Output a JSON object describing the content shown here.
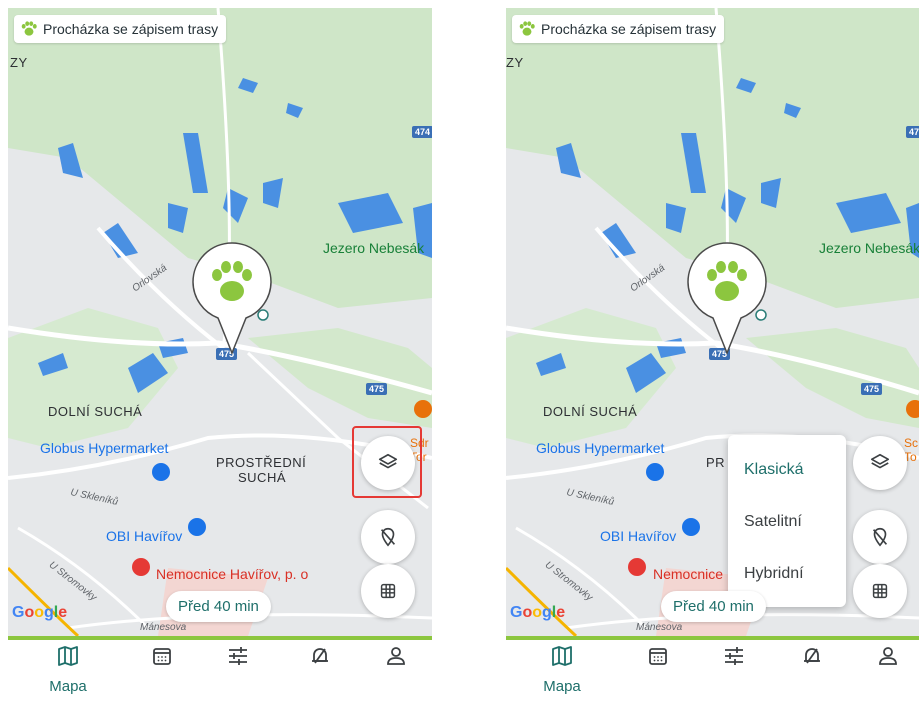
{
  "left": {
    "title": "Procházka se zápisem trasy",
    "map_labels": {
      "top_left_fragment": "ZY",
      "lake": "Jezero Nebesák",
      "dolni": "DOLNÍ SUCHÁ",
      "globus": "Globus Hypermarket",
      "prostredni_1": "PROSTŘEDNÍ",
      "prostredni_2": "SUCHÁ",
      "obi": "OBI Havířov",
      "hospital": "Nemocnice Havířov, p. o",
      "street_orlovska": "Orlovská",
      "street_sklenik": "U Skleníků",
      "street_stromovky": "U Stromovky",
      "street_manesova": "Mánesova",
      "edge_fragment_1": "Sdr",
      "edge_fragment_2": "Tor"
    },
    "road_shields": [
      "474",
      "475",
      "475"
    ],
    "time_chip": "Před 40 min",
    "google": "Google",
    "layers_highlighted": true
  },
  "right": {
    "title": "Procházka se zápisem trasy",
    "map_labels": {
      "top_left_fragment": "ZY",
      "lake": "Jezero Nebesák",
      "dolni": "DOLNÍ SUCHÁ",
      "globus": "Globus Hypermarket",
      "prostredni_fragment": "PR",
      "obi": "OBI Havířov",
      "hospital_fragment": "Nemocnice",
      "street_orlovska": "Orlovská",
      "street_sklenik": "U Skleníků",
      "street_stromovky": "U Stromovky",
      "street_manesova": "Mánesova",
      "edge_fragment_1": "Sc",
      "edge_fragment_2": "To"
    },
    "road_shields": [
      "47",
      "475",
      "475"
    ],
    "time_chip": "Před 40 min",
    "google": "Google",
    "map_type_menu": {
      "options": [
        "Klasická",
        "Satelitní",
        "Hybridní"
      ],
      "selected": "Klasická"
    }
  },
  "nav": {
    "active_label": "Mapa",
    "items": [
      "map-icon",
      "calendar-icon",
      "filter-icon",
      "notification-icon",
      "profile-icon"
    ]
  },
  "colors": {
    "accent": "#1e6f6a",
    "paw_green": "#8cc63f",
    "highlight_red": "#e53935",
    "water": "#4a90e2",
    "park": "#cfe6c8"
  }
}
